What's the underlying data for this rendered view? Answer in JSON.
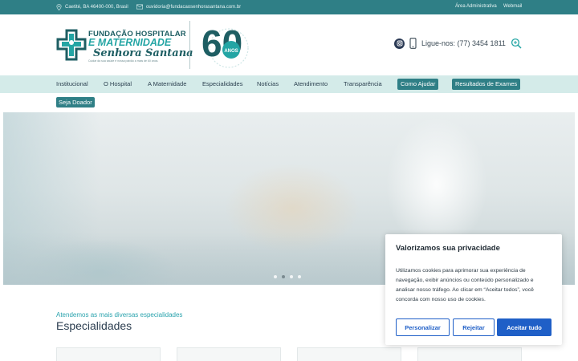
{
  "topbar": {
    "address": "Caetité, BA 46400-000, Brasil",
    "email": "ouvidoria@fundacaosenhorasantana.com.br",
    "admin_link": "Área Administrativa",
    "webmail_link": "Webmail"
  },
  "logo": {
    "line1": "FUNDAÇÃO HOSPITALAR",
    "line2": "E MATERNIDADE",
    "line3": "Senhora Santana",
    "tagline": "Cuidar da sua saúde é nossa paixão a mais de 60 anos.",
    "anniversary_number": "60",
    "anniversary_word": "ANOS"
  },
  "contact": {
    "phone_label": "Ligue-nos: (77) 3454 1811"
  },
  "nav": {
    "items": [
      "Institucional",
      "O Hospital",
      "A Maternidade",
      "Especialidades",
      "Notícias",
      "Atendimento",
      "Transparência"
    ],
    "highlight": [
      "Como Ajudar",
      "Resultados de Exames"
    ],
    "donor": "Seja Doador"
  },
  "specialties": {
    "subtitle": "Atendemos as mais diversas especialidades",
    "title": "Especialidades"
  },
  "cookie": {
    "title": "Valorizamos sua privacidade",
    "body": "Utilizamos cookies para aprimorar sua experiência de navegação, exibir anúncios ou conteúdo personalizado e analisar nosso tráfego. Ao clicar em “Aceitar todos”, você concorda com nosso uso de cookies.",
    "customize": "Personalizar",
    "reject": "Rejeitar",
    "accept": "Aceitar tudo"
  },
  "colors": {
    "topbar": "#2f7f86",
    "nav_bg": "#d4ebe9",
    "accent_teal": "#23a5a4",
    "cookie_blue": "#1f5fc7"
  },
  "icons": [
    "location-pin-icon",
    "mail-icon",
    "instagram-icon",
    "phone-icon",
    "search-icon"
  ]
}
